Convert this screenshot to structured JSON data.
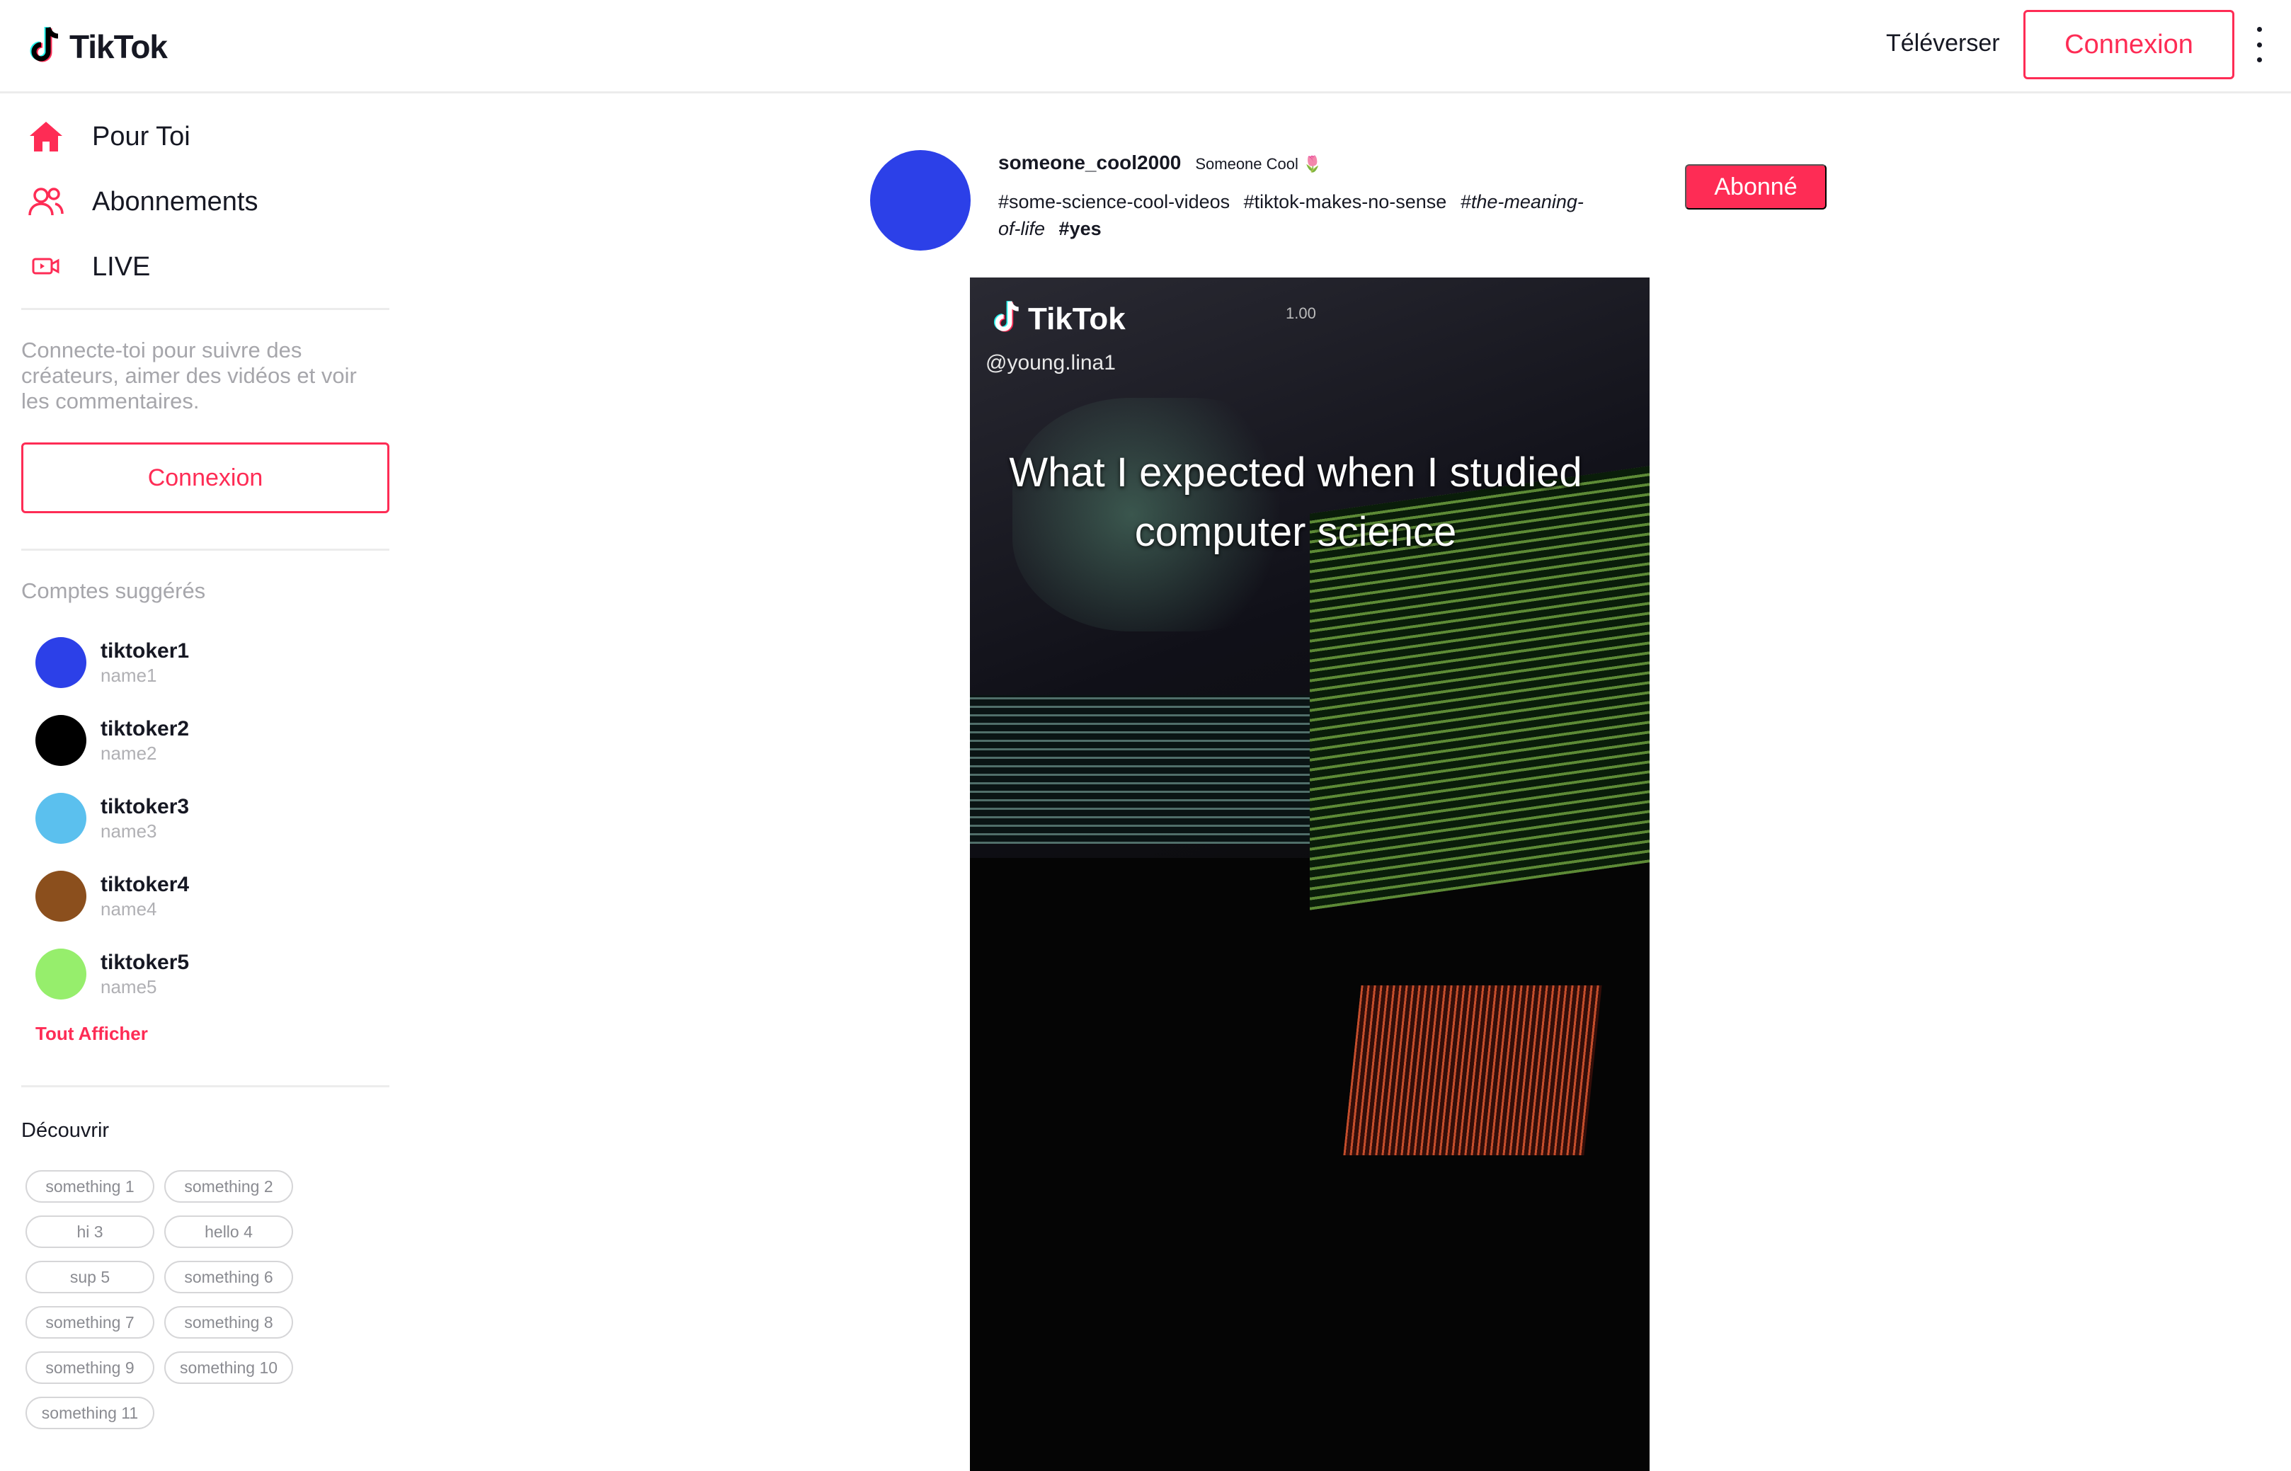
{
  "header": {
    "logo_text": "TikTok",
    "upload_label": "Téléverser",
    "login_label": "Connexion"
  },
  "sidebar": {
    "nav": [
      {
        "label": "Pour Toi",
        "icon": "home-icon"
      },
      {
        "label": "Abonnements",
        "icon": "users-icon"
      },
      {
        "label": "LIVE",
        "icon": "live-icon"
      }
    ],
    "login_hint": "Connecte-toi pour suivre des créateurs, aimer des vidéos et voir les commentaires.",
    "login_label": "Connexion",
    "suggested_title": "Comptes suggérés",
    "accounts": [
      {
        "username": "tiktoker1",
        "name": "name1",
        "color": "#2c40e8"
      },
      {
        "username": "tiktoker2",
        "name": "name2",
        "color": "#000000"
      },
      {
        "username": "tiktoker3",
        "name": "name3",
        "color": "#5bc0ee"
      },
      {
        "username": "tiktoker4",
        "name": "name4",
        "color": "#8b4f1d"
      },
      {
        "username": "tiktoker5",
        "name": "name5",
        "color": "#96ee6c"
      }
    ],
    "see_all_label": "Tout Afficher",
    "discover_title": "Découvrir",
    "discover_tags": [
      "something 1",
      "something 2",
      "hi 3",
      "hello 4",
      "sup 5",
      "something 6",
      "something 7",
      "something 8",
      "something 9",
      "something 10",
      "something 11"
    ]
  },
  "post": {
    "username": "someone_cool2000",
    "nickname": "Someone Cool 🌷",
    "avatar_color": "#2c40e8",
    "hashtags": [
      "#some-science-cool-videos",
      "#tiktok-makes-no-sense",
      "#the-meaning-of-life",
      "#yes"
    ],
    "follow_label": "Abonné",
    "video": {
      "logo_text": "TikTok",
      "handle": "@young.lina1",
      "time": "1.00",
      "title": "What I expected when I studied computer science"
    }
  },
  "colors": {
    "accent": "#fe2c55",
    "text": "#161823",
    "muted": "#a6a6ab"
  }
}
